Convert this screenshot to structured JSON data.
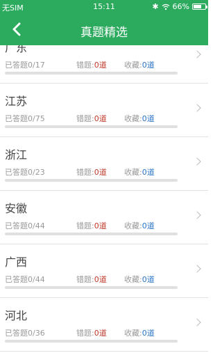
{
  "status_bar": {
    "carrier": "无SIM",
    "time": "15:11",
    "battery": "66%",
    "battery_level": 0.66
  },
  "header": {
    "title": "真题精选",
    "back_icon": "chevron-left-icon"
  },
  "colors": {
    "accent": "#2cab5f",
    "wrong": "#c0392b",
    "favorite": "#2a74c7"
  },
  "list": {
    "items": [
      {
        "province": "广东",
        "answered": "已答题0/17",
        "wrong_label": "错题:",
        "wrong_count": "0道",
        "fav_label": "收藏:",
        "fav_count": "0道",
        "progress": 0
      },
      {
        "province": "江苏",
        "answered": "已答题0/75",
        "wrong_label": "错题:",
        "wrong_count": "0道",
        "fav_label": "收藏:",
        "fav_count": "0道",
        "progress": 0
      },
      {
        "province": "浙江",
        "answered": "已答题0/23",
        "wrong_label": "错题:",
        "wrong_count": "0道",
        "fav_label": "收藏:",
        "fav_count": "0道",
        "progress": 0
      },
      {
        "province": "安徽",
        "answered": "已答题0/44",
        "wrong_label": "错题:",
        "wrong_count": "0道",
        "fav_label": "收藏:",
        "fav_count": "0道",
        "progress": 0
      },
      {
        "province": "广西",
        "answered": "已答题0/44",
        "wrong_label": "错题:",
        "wrong_count": "0道",
        "fav_label": "收藏:",
        "fav_count": "0道",
        "progress": 0
      },
      {
        "province": "河北",
        "answered": "已答题0/36",
        "wrong_label": "错题:",
        "wrong_count": "0道",
        "fav_label": "收藏:",
        "fav_count": "0道",
        "progress": 0
      }
    ]
  }
}
